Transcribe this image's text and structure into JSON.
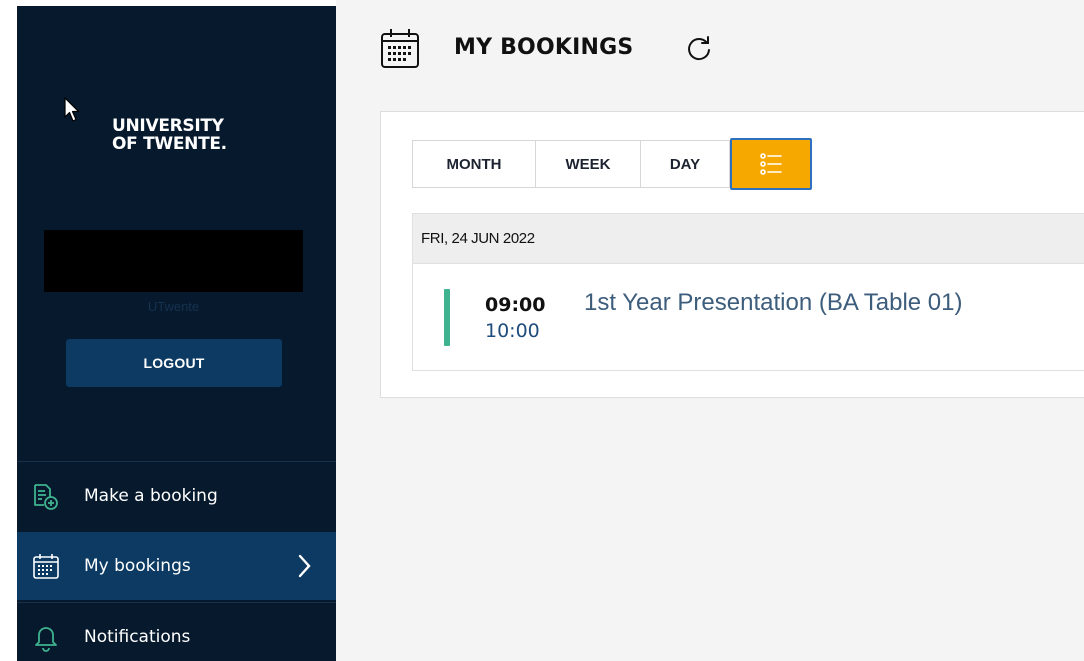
{
  "sidebar": {
    "logo": {
      "line1": "UNIVERSITY",
      "line2": "OF TWENTE."
    },
    "organization": "UTwente",
    "logout_label": "LOGOUT",
    "items": [
      {
        "label": "Make a booking",
        "icon": "document-plus-icon",
        "active": false
      },
      {
        "label": "My bookings",
        "icon": "calendar-icon",
        "active": true
      },
      {
        "label": "Notifications",
        "icon": "bell-icon",
        "active": false
      }
    ]
  },
  "header": {
    "title": "MY BOOKINGS",
    "icon": "calendar-icon",
    "refresh_icon": "refresh-icon"
  },
  "view_tabs": [
    {
      "label": "MONTH",
      "active": false
    },
    {
      "label": "WEEK",
      "active": false
    },
    {
      "label": "DAY",
      "active": false
    },
    {
      "label": "",
      "icon": "list-icon",
      "active": true
    }
  ],
  "bookings": {
    "date": "FRI, 24 JUN 2022",
    "items": [
      {
        "start": "09:00",
        "end": "10:00",
        "title": "1st Year Presentation (BA Table 01)"
      }
    ]
  },
  "colors": {
    "sidebar_bg": "#06192d",
    "accent_blue": "#0c3a63",
    "active_tab": "#f7a800",
    "active_tab_border": "#2f6fbf",
    "booking_accent": "#3fb38f"
  }
}
